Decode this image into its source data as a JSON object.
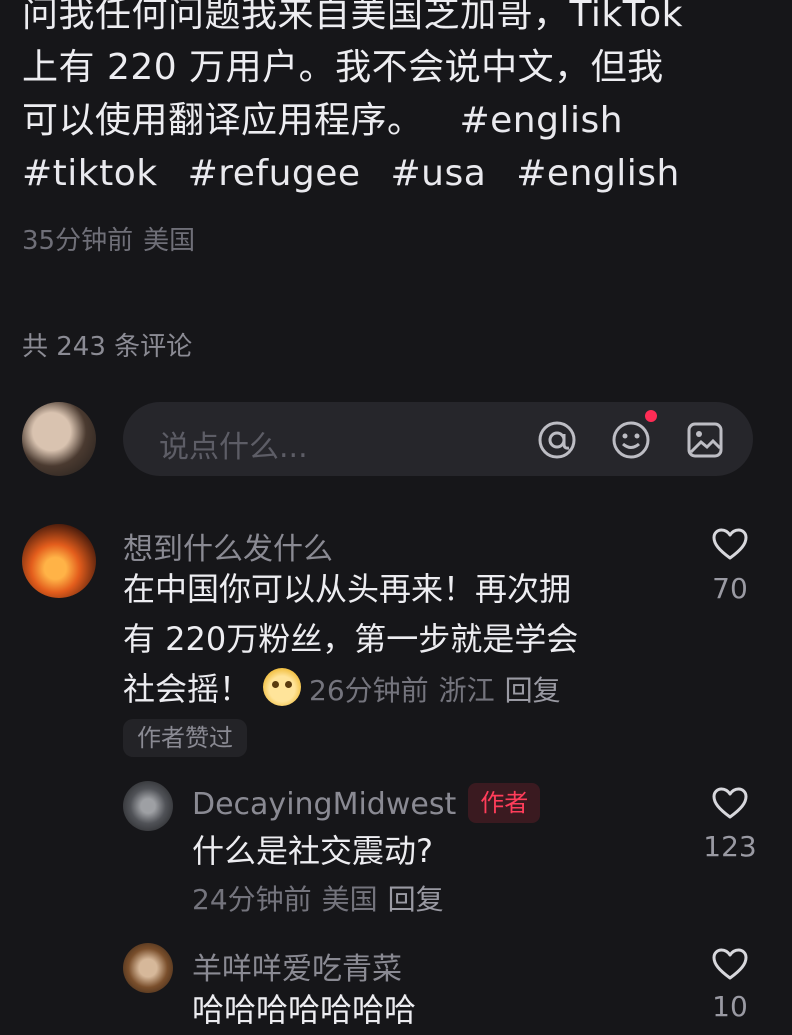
{
  "post": {
    "text_lines": [
      "问我任何问题我来自美国芝加哥，TikTok",
      "上有 220 万用户。我不会说中文，但我",
      "可以使用翻译应用程序。"
    ],
    "hashtags_line1": "#english",
    "hashtags_line2": [
      "#tiktok",
      "#refugee",
      "#usa",
      "#english"
    ],
    "time": "35分钟前",
    "location": "美国"
  },
  "comments_header": {
    "count_label": "共 243 条评论"
  },
  "composer": {
    "placeholder": "说点什么..."
  },
  "comments": [
    {
      "username": "想到什么发什么",
      "text_lines": [
        "在中国你可以从头再来！再次拥",
        "有 220万粉丝，第一步就是学会",
        "社会摇！"
      ],
      "time": "26分钟前",
      "location": "浙江",
      "reply_label": "回复",
      "likes": "70",
      "badge": "作者赞过"
    }
  ],
  "replies": [
    {
      "username": "DecayingMidwest",
      "author_tag": "作者",
      "text": "什么是社交震动?",
      "time": "24分钟前",
      "location": "美国",
      "reply_label": "回复",
      "likes": "123"
    },
    {
      "username": "羊咩咩爱吃青菜",
      "text": "哈哈哈哈哈哈哈",
      "likes": "10"
    }
  ],
  "colors": {
    "background": "#161619",
    "accent_red": "#ff2c55"
  }
}
